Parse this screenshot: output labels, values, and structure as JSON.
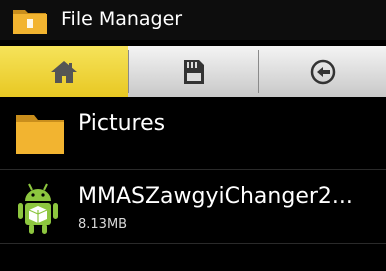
{
  "app": {
    "title": "File Manager",
    "icon": "folder-icon"
  },
  "tabs": [
    {
      "icon": "home-icon",
      "active": true
    },
    {
      "icon": "sd-card-icon",
      "active": false
    },
    {
      "icon": "back-arrow-icon",
      "active": false
    }
  ],
  "files": [
    {
      "name": "Pictures",
      "type": "folder",
      "icon": "folder-icon",
      "size": ""
    },
    {
      "name": "MMASZawgyiChanger2...",
      "type": "apk",
      "icon": "android-icon",
      "size": "8.13MB"
    }
  ],
  "colors": {
    "accent": "#e8c823",
    "background": "#000000",
    "folder": "#f2b430",
    "android": "#8dc63f"
  }
}
